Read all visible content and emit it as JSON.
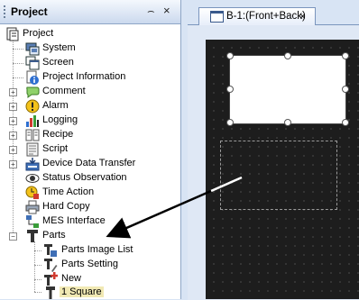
{
  "panel": {
    "title": "Project",
    "pin_glyph": "⌢",
    "close_glyph": "×"
  },
  "tree": {
    "root": "Project",
    "items": [
      {
        "label": "System",
        "icon": "system-icon"
      },
      {
        "label": "Screen",
        "icon": "screen-icon"
      },
      {
        "label": "Project Information",
        "icon": "info-icon"
      },
      {
        "label": "Comment",
        "icon": "comment-icon"
      },
      {
        "label": "Alarm",
        "icon": "alarm-icon"
      },
      {
        "label": "Logging",
        "icon": "logging-icon"
      },
      {
        "label": "Recipe",
        "icon": "recipe-icon"
      },
      {
        "label": "Script",
        "icon": "script-icon"
      },
      {
        "label": "Device Data Transfer",
        "icon": "device-data-transfer-icon"
      },
      {
        "label": "Status Observation",
        "icon": "status-observation-icon"
      },
      {
        "label": "Time Action",
        "icon": "time-action-icon"
      },
      {
        "label": "Hard Copy",
        "icon": "hard-copy-icon"
      },
      {
        "label": "MES Interface",
        "icon": "mes-interface-icon"
      },
      {
        "label": "Parts",
        "icon": "parts-icon"
      }
    ],
    "parts_children": [
      {
        "label": "Parts Image List",
        "icon": "parts-image-list-icon"
      },
      {
        "label": "Parts Setting",
        "icon": "parts-setting-icon"
      },
      {
        "label": "New",
        "icon": "new-part-icon"
      },
      {
        "label": "1 Square",
        "icon": "part-icon"
      }
    ],
    "expand_glyph": "+",
    "collapse_glyph": "−"
  },
  "editor": {
    "tab_label": "B-1:(Front+Back)",
    "tab_close": "×"
  },
  "colors": {
    "canvas": "#1d1d1d",
    "panel_header": "#cbd9ee",
    "selection": "#f1e9b4",
    "arrow": "#000000"
  }
}
